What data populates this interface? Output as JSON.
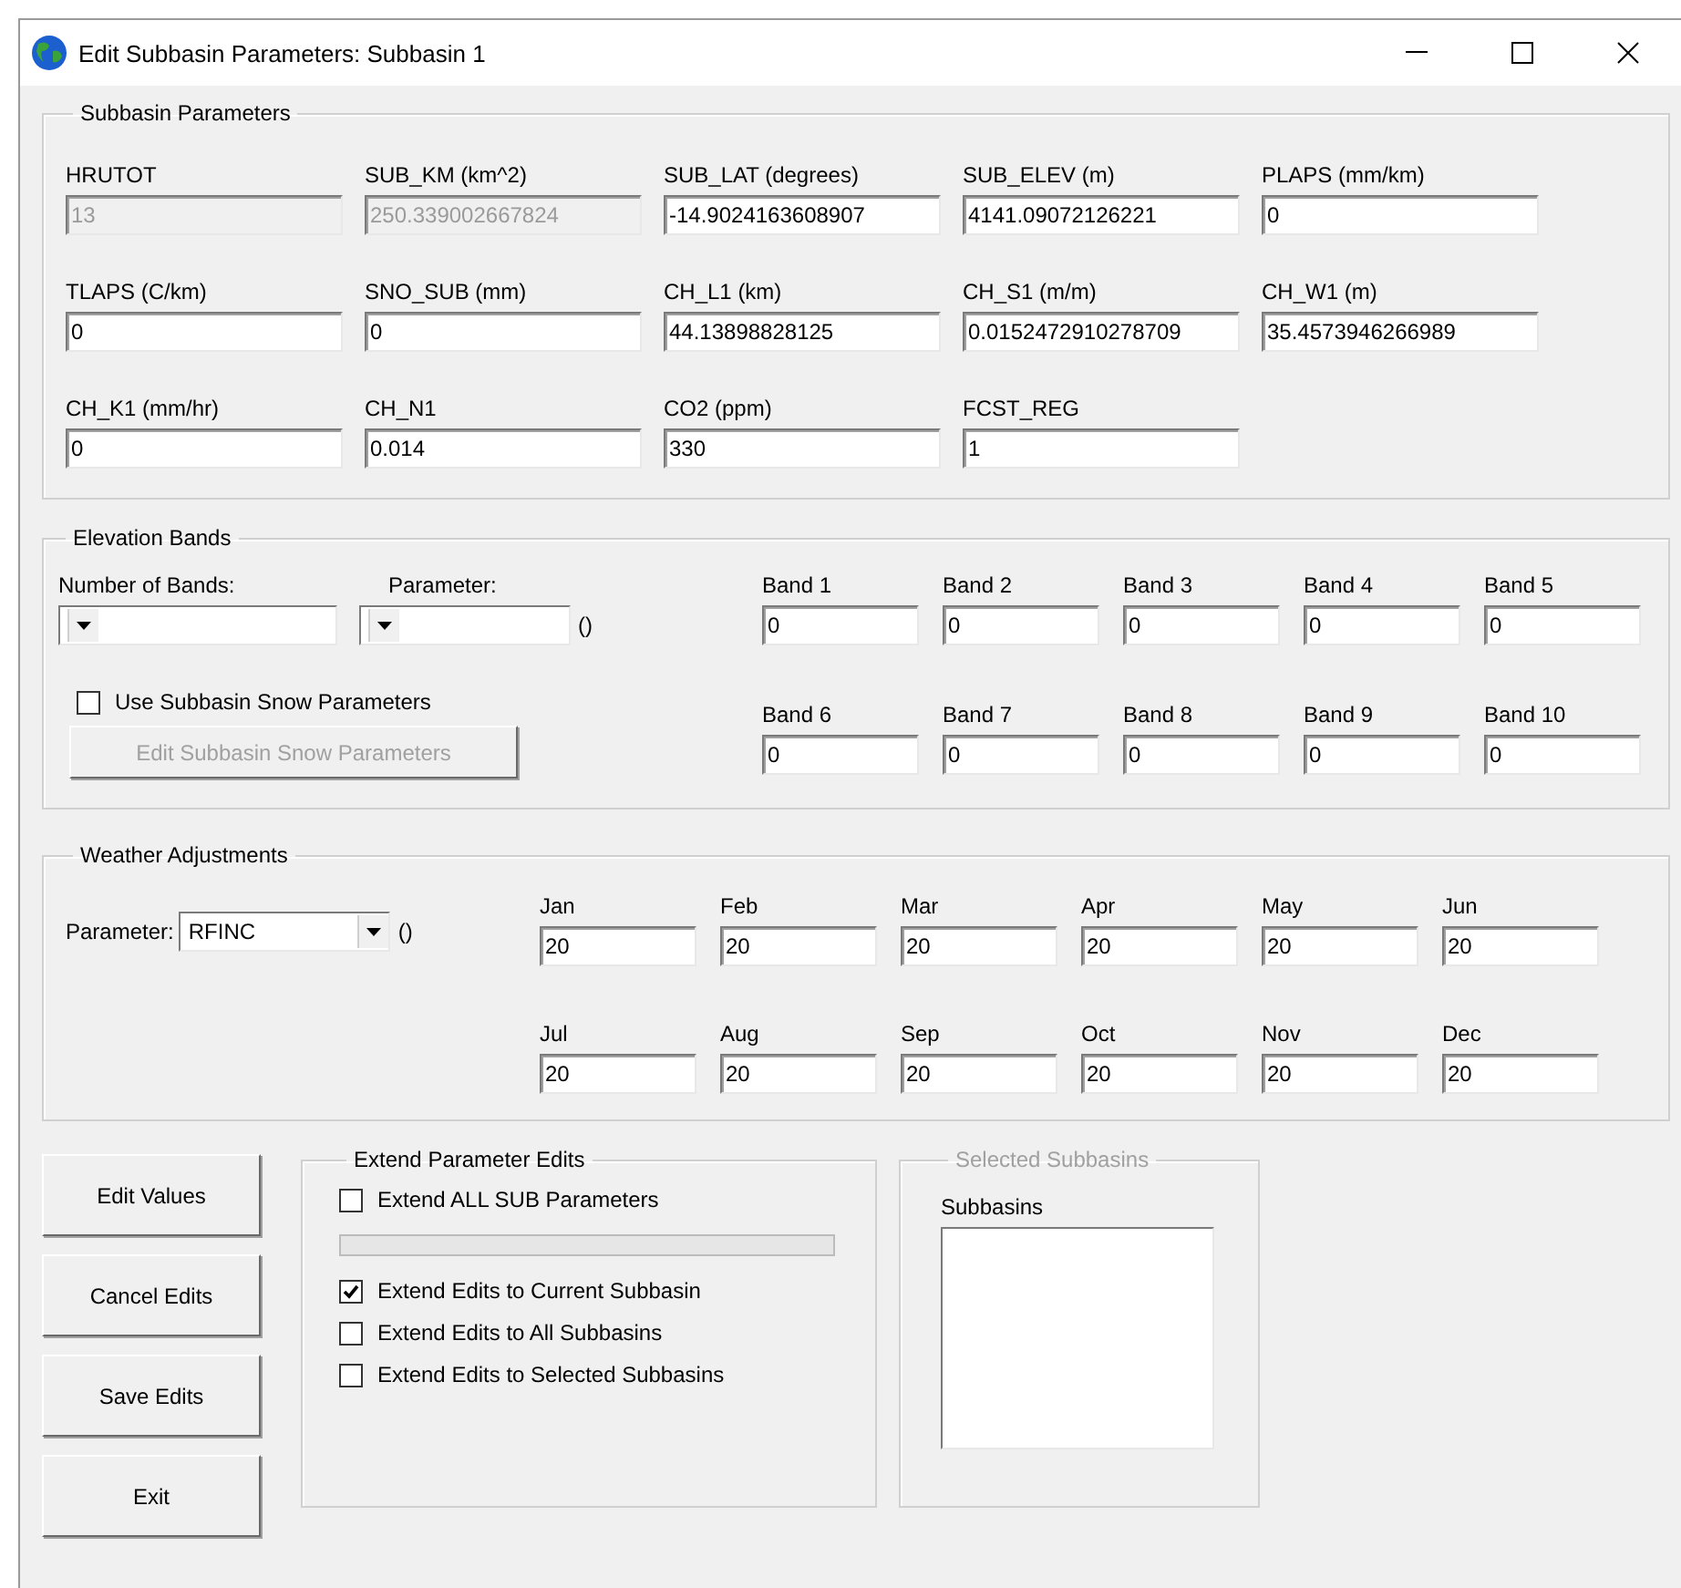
{
  "window": {
    "title": "Edit Subbasin Parameters: Subbasin 1"
  },
  "subbasin_parameters": {
    "title": "Subbasin Parameters",
    "fields": [
      {
        "label": "HRUTOT",
        "value": "13",
        "disabled": true
      },
      {
        "label": "SUB_KM (km^2)",
        "value": "250.339002667824",
        "disabled": true
      },
      {
        "label": "SUB_LAT (degrees)",
        "value": "-14.9024163608907",
        "disabled": false
      },
      {
        "label": "SUB_ELEV (m)",
        "value": "4141.09072126221",
        "disabled": false
      },
      {
        "label": "PLAPS (mm/km)",
        "value": "0",
        "disabled": false
      },
      {
        "label": "TLAPS (C/km)",
        "value": "0",
        "disabled": false
      },
      {
        "label": "SNO_SUB (mm)",
        "value": "0",
        "disabled": false
      },
      {
        "label": "CH_L1 (km)",
        "value": "44.13898828125",
        "disabled": false
      },
      {
        "label": "CH_S1 (m/m)",
        "value": "0.0152472910278709",
        "disabled": false
      },
      {
        "label": "CH_W1 (m)",
        "value": "35.4573946266989",
        "disabled": false
      },
      {
        "label": "CH_K1 (mm/hr)",
        "value": "0",
        "disabled": false
      },
      {
        "label": "CH_N1",
        "value": "0.014",
        "disabled": false
      },
      {
        "label": "CO2 (ppm)",
        "value": "330",
        "disabled": false
      },
      {
        "label": "FCST_REG",
        "value": "1",
        "disabled": false
      }
    ]
  },
  "elevation_bands": {
    "title": "Elevation Bands",
    "number_of_bands_label": "Number of Bands:",
    "parameter_label": "Parameter:",
    "parameter_units": "()",
    "use_snow": {
      "label": "Use Subbasin Snow Parameters",
      "checked": false
    },
    "snow_button": {
      "label": "Edit Subbasin Snow Parameters",
      "disabled": true
    },
    "bands": [
      {
        "label": "Band 1",
        "value": "0"
      },
      {
        "label": "Band 2",
        "value": "0"
      },
      {
        "label": "Band 3",
        "value": "0"
      },
      {
        "label": "Band 4",
        "value": "0"
      },
      {
        "label": "Band 5",
        "value": "0"
      },
      {
        "label": "Band 6",
        "value": "0"
      },
      {
        "label": "Band 7",
        "value": "0"
      },
      {
        "label": "Band 8",
        "value": "0"
      },
      {
        "label": "Band 9",
        "value": "0"
      },
      {
        "label": "Band 10",
        "value": "0"
      }
    ]
  },
  "weather_adjustments": {
    "title": "Weather Adjustments",
    "parameter_label": "Parameter:",
    "parameter_value": "RFINC",
    "parameter_units": "()",
    "months": [
      {
        "label": "Jan",
        "value": "20"
      },
      {
        "label": "Feb",
        "value": "20"
      },
      {
        "label": "Mar",
        "value": "20"
      },
      {
        "label": "Apr",
        "value": "20"
      },
      {
        "label": "May",
        "value": "20"
      },
      {
        "label": "Jun",
        "value": "20"
      },
      {
        "label": "Jul",
        "value": "20"
      },
      {
        "label": "Aug",
        "value": "20"
      },
      {
        "label": "Sep",
        "value": "20"
      },
      {
        "label": "Oct",
        "value": "20"
      },
      {
        "label": "Nov",
        "value": "20"
      },
      {
        "label": "Dec",
        "value": "20"
      }
    ]
  },
  "buttons": [
    "Edit Values",
    "Cancel Edits",
    "Save Edits",
    "Exit"
  ],
  "extend_parameter_edits": {
    "title": "Extend Parameter Edits",
    "items": [
      {
        "kind": "checkbox",
        "label": "Extend ALL SUB Parameters",
        "checked": false
      },
      {
        "kind": "progress",
        "level": 0
      },
      {
        "kind": "checkbox",
        "label": "Extend Edits to Current Subbasin",
        "checked": true
      },
      {
        "kind": "checkbox",
        "label": "Extend Edits to All Subbasins",
        "checked": false
      },
      {
        "kind": "checkbox",
        "label": "Extend Edits to Selected Subbasins",
        "checked": false
      }
    ]
  },
  "selected_subbasins": {
    "title": "Selected Subbasins",
    "disabled": true,
    "list_label": "Subbasins"
  }
}
